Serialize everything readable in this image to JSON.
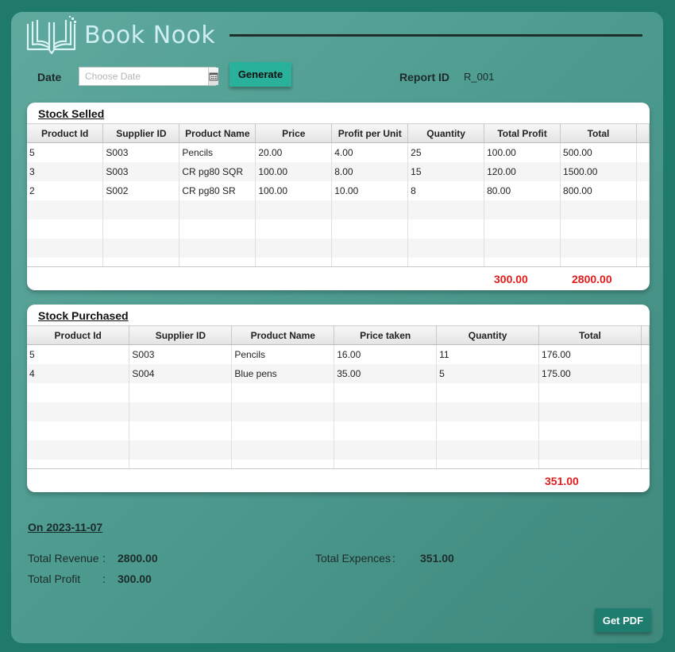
{
  "app": {
    "title": "Book Nook",
    "logo_icon": "open-book-icon"
  },
  "toolbar": {
    "date_label": "Date",
    "date_placeholder": "Choose Date",
    "generate_label": "Generate",
    "report_id_label": "Report ID",
    "report_id_value": "R_001"
  },
  "stock_selled": {
    "title": "Stock Selled",
    "columns": [
      "Product Id",
      "Supplier ID",
      "Product Name",
      "Price",
      "Profit per Unit",
      "Quantity",
      "Total Profit",
      "Total"
    ],
    "rows": [
      [
        "5",
        "S003",
        "Pencils",
        "20.00",
        "4.00",
        "25",
        "100.00",
        "500.00"
      ],
      [
        "3",
        "S003",
        "CR pg80 SQR",
        "100.00",
        "8.00",
        "15",
        "120.00",
        "1500.00"
      ],
      [
        "2",
        "S002",
        "CR pg80 SR",
        "100.00",
        "10.00",
        "8",
        "80.00",
        "800.00"
      ]
    ],
    "total_profit": "300.00",
    "total": "2800.00"
  },
  "stock_purchased": {
    "title": "Stock Purchased",
    "columns": [
      "Product Id",
      "Supplier ID",
      "Product Name",
      "Price taken",
      "Quantity",
      "Total"
    ],
    "rows": [
      [
        "5",
        "S003",
        "Pencils",
        "16.00",
        "11",
        "176.00"
      ],
      [
        "4",
        "S004",
        "Blue pens",
        "35.00",
        "5",
        "175.00"
      ]
    ],
    "total": "351.00"
  },
  "summary": {
    "on_date": "On 2023-11-07",
    "total_revenue_label": "Total Revenue",
    "total_revenue_value": "2800.00",
    "total_profit_label": "Total Profit",
    "total_profit_value": "300.00",
    "total_expences_label": "Total Expences",
    "total_expences_value": "351.00",
    "colon": ":"
  },
  "actions": {
    "get_pdf_label": "Get PDF"
  },
  "colors": {
    "background": "#1f7a6a",
    "accent": "#2ab19b",
    "total_red": "#e21b1b"
  }
}
